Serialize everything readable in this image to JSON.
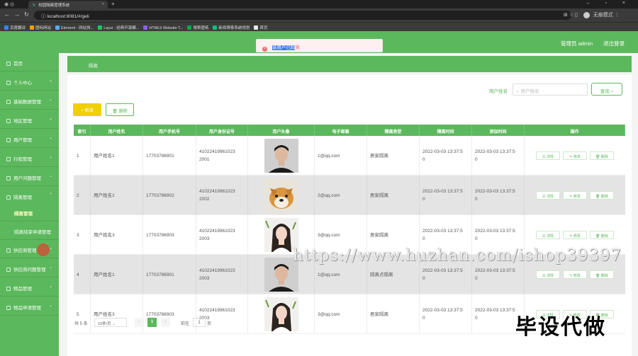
{
  "browser": {
    "tab_title": "校园隔离管理系统",
    "url": "localhost:8081/#/geli",
    "incognito_label": "无痕模式",
    "bookmarks": [
      {
        "label": "百度翻译",
        "color": "#3b82f6"
      },
      {
        "label": "图标网站",
        "color": "#f59e0b"
      },
      {
        "label": "Element - 网站快...",
        "color": "#60a5fa"
      },
      {
        "label": "Layui - 经典开源模...",
        "color": "#22c55e"
      },
      {
        "label": "HTML5 Website T...",
        "color": "#8b5cf6"
      },
      {
        "label": "搜索壁纸",
        "color": "#16a34a"
      },
      {
        "label": "新闻博客系统规划",
        "color": "#10b981"
      },
      {
        "label": "首页",
        "color": "#e5e7eb"
      }
    ]
  },
  "header": {
    "admin_label": "管理员 admin",
    "logout_label": "退出登录"
  },
  "toast": {
    "message_selected": "该用户已隔",
    "message_rest": "离"
  },
  "sidebar": {
    "items": [
      {
        "label": "首页",
        "chevron": false
      },
      {
        "label": "个人中心",
        "chevron": true
      },
      {
        "label": "基础数据管理",
        "chevron": true
      },
      {
        "label": "地区管理",
        "chevron": true
      },
      {
        "label": "用户管理",
        "chevron": true
      },
      {
        "label": "行程管理",
        "chevron": true
      },
      {
        "label": "用户问题管理",
        "chevron": true
      },
      {
        "label": "隔离管理",
        "chevron": true,
        "open": true
      },
      {
        "label": "隔离管理",
        "sub": true,
        "active": true
      },
      {
        "label": "隔离结束申请管理",
        "sub": true
      },
      {
        "label": "供应商管理",
        "chevron": true
      },
      {
        "label": "供应商问题管理",
        "chevron": true
      },
      {
        "label": "物品管理",
        "chevron": true
      },
      {
        "label": "物品申请管理",
        "chevron": true
      }
    ]
  },
  "breadcrumb": "隔离",
  "search": {
    "label": "用户姓名",
    "placeholder": "用户姓名",
    "button": "查询"
  },
  "actions": {
    "add": "新增",
    "delete": "删除"
  },
  "table": {
    "columns": [
      "索引",
      "用户姓名",
      "用户手机号",
      "用户身份证号",
      "用户头像",
      "电子邮箱",
      "隔离类型",
      "隔离时间",
      "添加时间",
      "操作"
    ],
    "op_labels": {
      "detail": "详情",
      "edit": "修改",
      "delete": "删除"
    },
    "rows": [
      {
        "index": "1",
        "name": "用户姓名1",
        "phone": "17703786901",
        "idcard": "41022419961023\n2001",
        "avatar": "man",
        "email": "1@qq.com",
        "type": "居家隔离",
        "geli_time": "2022-03-03 13:37:5\n0",
        "add_time": "2022-03-03 13:37:5\n0"
      },
      {
        "index": "2",
        "name": "用户姓名2",
        "phone": "17703786902",
        "idcard": "41022419961023\n2002",
        "avatar": "dog",
        "email": "2@qq.com",
        "type": "居家隔离",
        "geli_time": "2022-03-03 13:37:5\n0",
        "add_time": "2022-03-03 13:37:5\n0"
      },
      {
        "index": "3",
        "name": "用户姓名3",
        "phone": "17703786903",
        "idcard": "41022419961023\n2003",
        "avatar": "woman",
        "email": "3@qq.com",
        "type": "居家隔离",
        "geli_time": "2022-03-03 13:37:5\n0",
        "add_time": "2022-03-03 13:37:5\n0"
      },
      {
        "index": "4",
        "name": "用户姓名1",
        "phone": "17703786901",
        "idcard": "41022419961023\n2003",
        "avatar": "man",
        "email": "1@qq.com",
        "type": "隔离点隔离",
        "geli_time": "2022-03-03 13:37:5\n0",
        "add_time": "2022-03-03 13:37:5\n0"
      },
      {
        "index": "5",
        "name": "用户姓名3",
        "phone": "17703786903",
        "idcard": "41022419961023\n2003",
        "avatar": "woman",
        "email": "3@qq.com",
        "type": "居家隔离",
        "geli_time": "2022-03-03 13:37:5\n0",
        "add_time": "2022-03-03 13:37:5\n0"
      }
    ]
  },
  "pager": {
    "total": "共 5 条",
    "page_size": "10条/页",
    "current": "1",
    "goto": "前往",
    "input": "1",
    "unit": "页"
  },
  "watermark": {
    "url": "https://www.huzhan.com/ishop39397",
    "cn": "毕设代做"
  },
  "colors": {
    "primary": "#5cb85c",
    "add_button": "#f0d000",
    "error": "#f56c6c"
  }
}
